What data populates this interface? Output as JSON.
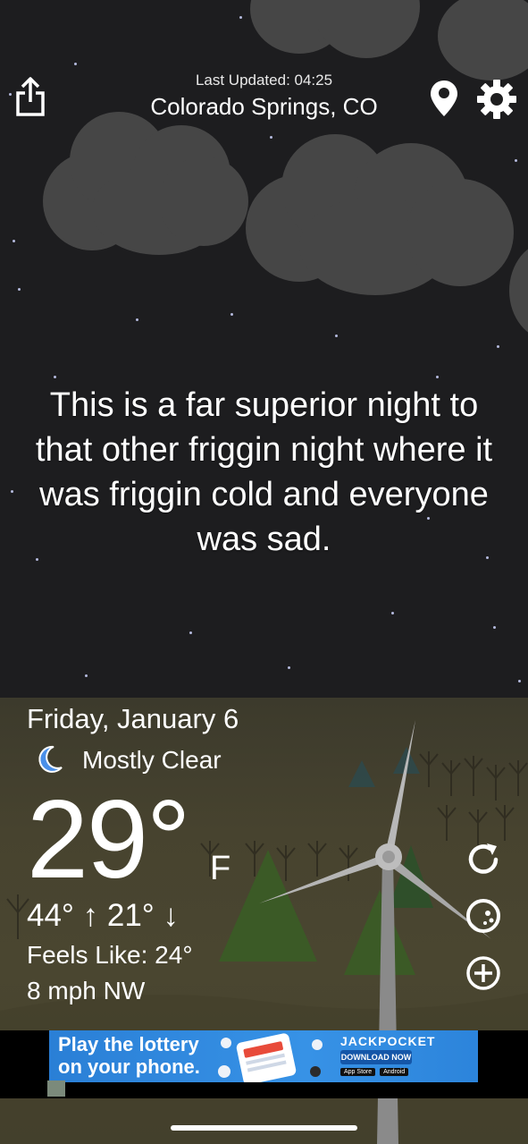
{
  "header": {
    "last_updated": "Last Updated: 04:25",
    "location": "Colorado Springs, CO"
  },
  "quote": "This is a far superior night to that other friggin night where it was friggin cold and everyone was sad.",
  "weather": {
    "date": "Friday, January 6",
    "condition": "Mostly Clear",
    "temperature": "29°",
    "unit": "F",
    "high_low": "44° ↑ 21° ↓",
    "feels_like": "Feels Like: 24°",
    "wind": "8 mph NW"
  },
  "ad": {
    "headline_line1": "Play the lottery",
    "headline_line2": "on your phone.",
    "brand": "JACKPOCKET",
    "cta": "DOWNLOAD NOW",
    "store1": "App Store",
    "store2": "Android"
  },
  "icons": [
    "share-icon",
    "location-pin-icon",
    "gear-icon",
    "moon-icon",
    "refresh-icon",
    "radar-icon",
    "add-icon"
  ],
  "colors": {
    "sky": "#1d1d1f",
    "ground": "#47432f",
    "cloud": "#464646",
    "moon": "#4a8fe8",
    "ad": "#3792e6"
  }
}
